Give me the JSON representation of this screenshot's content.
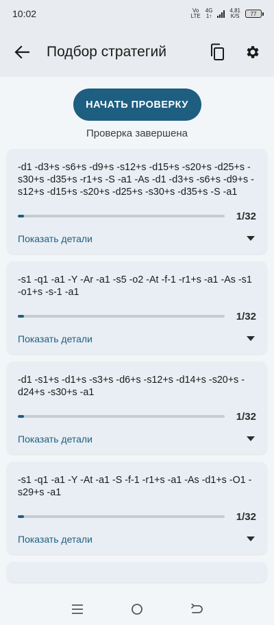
{
  "status_bar": {
    "time": "10:02",
    "carrier_top": "Vo",
    "carrier_bottom": "LTE",
    "network_top": "4G",
    "network_bottom": "1↑",
    "speed_value": "4,81",
    "speed_unit": "K/S",
    "battery": "77"
  },
  "app_bar": {
    "title": "Подбор стратегий",
    "icons": [
      "arrow-back-icon",
      "copy-icon",
      "gear-icon"
    ]
  },
  "controls": {
    "start_button": "НАЧАТЬ ПРОВЕРКУ",
    "status": "Проверка завершена"
  },
  "colors": {
    "accent": "#1e5e81",
    "card_bg": "#e8eef3",
    "page_bg": "#f3f6f9",
    "track": "#c5ccd3"
  },
  "strategies": [
    {
      "text": "-d1 -d3+s -s6+s -d9+s -s12+s -d15+s -s20+s -d25+s -s30+s -d35+s -r1+s -S -a1 -As -d1 -d3+s -s6+s -d9+s -s12+s -d15+s -s20+s -d25+s -s30+s -d35+s -S -a1",
      "progress": 0.03125,
      "count": "1/32",
      "details_label": "Показать детали"
    },
    {
      "text": "-s1 -q1 -a1 -Y -Ar -a1 -s5 -o2 -At -f-1 -r1+s -a1 -As -s1 -o1+s -s-1 -a1",
      "progress": 0.03125,
      "count": "1/32",
      "details_label": "Показать детали"
    },
    {
      "text": "-d1 -s1+s -d1+s -s3+s -d6+s -s12+s -d14+s -s20+s -d24+s -s30+s -a1",
      "progress": 0.03125,
      "count": "1/32",
      "details_label": "Показать детали"
    },
    {
      "text": "-s1 -q1 -a1 -Y -At -a1 -S -f-1 -r1+s -a1 -As -d1+s -O1 -s29+s -a1",
      "progress": 0.03125,
      "count": "1/32",
      "details_label": "Показать детали"
    }
  ],
  "nav_bar": {
    "icons": [
      "menu-icon",
      "home-icon",
      "back-icon"
    ]
  }
}
